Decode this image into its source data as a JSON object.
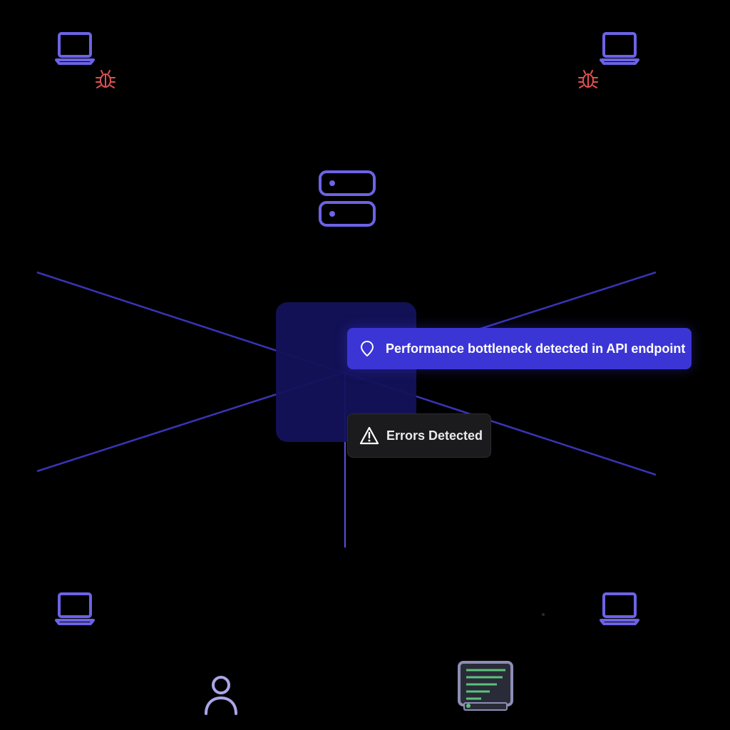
{
  "notifications": {
    "primary": {
      "icon": "map-pin-icon",
      "text": "Performance bottleneck detected in API endpoint"
    },
    "secondary": {
      "icon": "warning-triangle-icon",
      "text": "Errors Detected"
    }
  },
  "nodes": {
    "clients": [
      "laptop-icon",
      "laptop-icon",
      "laptop-icon",
      "laptop-icon"
    ],
    "server": "server-icon",
    "bugs": [
      "bug-icon",
      "bug-icon"
    ],
    "user": "user-icon",
    "logs": "log-document-icon"
  },
  "colors": {
    "background": "#000000",
    "node_stroke": "#6c63e6",
    "connection_line": "#3a34b8",
    "bug": "#e35050",
    "primary_toast": "#3b35d6",
    "secondary_toast": "#1b1b1e",
    "log_text": "#5cc27a",
    "user_stroke": "#a9a6e8"
  }
}
